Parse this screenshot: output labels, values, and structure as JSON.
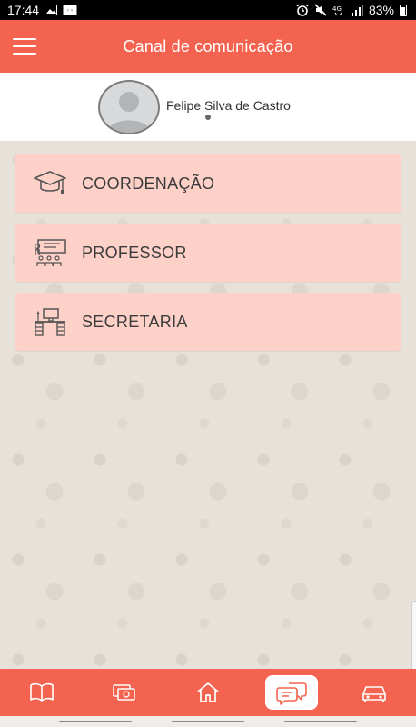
{
  "status_bar": {
    "time": "17:44",
    "battery": "83%",
    "network_label": "4G",
    "icons": [
      "image-icon",
      "cast-icon",
      "alarm-icon",
      "mute-icon",
      "signal-icon",
      "battery-icon"
    ]
  },
  "header": {
    "title": "Canal de comunicação",
    "menu_icon": "hamburger-icon"
  },
  "profile": {
    "name": "Felipe Silva de Castro",
    "avatar_icon": "default-avatar-icon"
  },
  "menu": {
    "items": [
      {
        "label": "COORDENAÇÃO",
        "icon": "graduation-cap-icon"
      },
      {
        "label": "PROFESSOR",
        "icon": "teacher-icon"
      },
      {
        "label": "SECRETARIA",
        "icon": "office-desk-icon"
      }
    ]
  },
  "bottom_nav": {
    "items": [
      {
        "icon": "book-icon",
        "active": false
      },
      {
        "icon": "money-icon",
        "active": false
      },
      {
        "icon": "home-icon",
        "active": false
      },
      {
        "icon": "chat-icon",
        "active": true
      },
      {
        "icon": "car-icon",
        "active": false
      }
    ]
  },
  "colors": {
    "primary": "#f4634f",
    "card": "#fdd0c8",
    "background": "#e7e1da"
  }
}
